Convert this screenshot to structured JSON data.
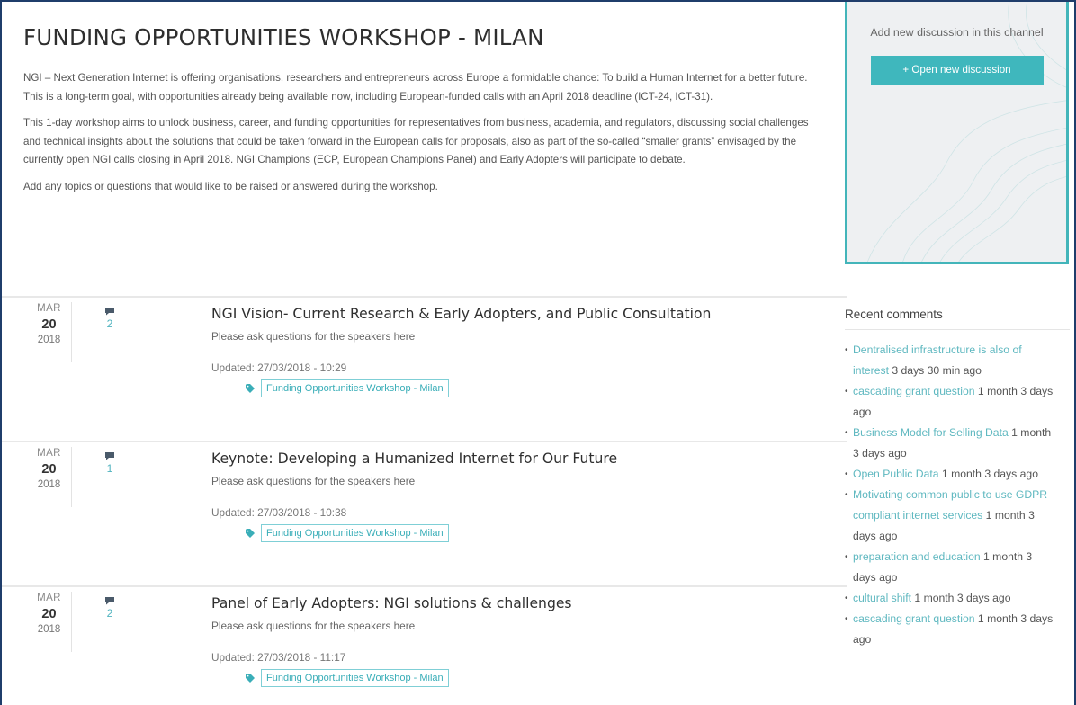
{
  "page": {
    "title": "FUNDING OPPORTUNITIES WORKSHOP - MILAN",
    "intro": [
      "NGI – Next Generation Internet is offering organisations, researchers and entrepreneurs across Europe a formidable chance: To build a Human Internet for a better future. This is a long-term goal, with opportunities already being available now, including European-funded calls with an April 2018 deadline (ICT-24, ICT-31).",
      "This 1-day workshop aims to unlock business, career, and funding opportunities for representatives from business, academia, and regulators, discussing social challenges and technical insights about the solutions that could be taken forward in the European calls for proposals, also as part of the so-called “smaller grants” envisaged by the currently open NGI calls closing in April 2018. NGI Champions (ECP, European Champions Panel) and Early Adopters will participate to debate.",
      "Add any topics or questions that would like to be raised or answered during the workshop."
    ]
  },
  "topics": [
    {
      "month": "MAR",
      "day": "20",
      "year": "2018",
      "comments": "2",
      "title": "NGI Vision- Current Research & Early Adopters, and Public Consultation",
      "subtitle": "Please ask questions for the speakers here",
      "updated": "Updated: 27/03/2018 - 10:29",
      "tag": "Funding Opportunities Workshop - Milan"
    },
    {
      "month": "MAR",
      "day": "20",
      "year": "2018",
      "comments": "1",
      "title": "Keynote: Developing a Humanized Internet for Our Future",
      "subtitle": "Please ask questions for the speakers here",
      "updated": "Updated: 27/03/2018 - 10:38",
      "tag": "Funding Opportunities Workshop - Milan"
    },
    {
      "month": "MAR",
      "day": "20",
      "year": "2018",
      "comments": "2",
      "title": "Panel of Early Adopters: NGI solutions & challenges",
      "subtitle": "Please ask questions for the speakers here",
      "updated": "Updated: 27/03/2018 - 11:17",
      "tag": "Funding Opportunities Workshop - Milan"
    }
  ],
  "sidebar": {
    "new_discussion_label": "Add new discussion in this channel",
    "open_button": "+ Open new discussion",
    "recent_title": "Recent comments",
    "recent": [
      {
        "link": "Dentralised infrastructure is also of interest",
        "ago": " 3 days 30 min ago"
      },
      {
        "link": "cascading grant question",
        "ago": " 1 month 3 days ago"
      },
      {
        "link": "Business Model for Selling Data",
        "ago": " 1 month 3 days ago"
      },
      {
        "link": "Open Public Data",
        "ago": " 1 month 3 days ago"
      },
      {
        "link": "Motivating common public to use GDPR compliant internet services",
        "ago": " 1 month 3 days ago"
      },
      {
        "link": "preparation and education",
        "ago": " 1 month 3 days ago"
      },
      {
        "link": "cultural shift",
        "ago": " 1 month 3 days ago"
      },
      {
        "link": "cascading grant question",
        "ago": " 1 month 3 days ago"
      }
    ]
  },
  "icons": {
    "comment": "comment-bubble-icon",
    "tag": "tag-icon"
  },
  "colors": {
    "accent": "#3fb7bd",
    "link": "#5fb8c0",
    "frame": "#1f3d6b"
  }
}
